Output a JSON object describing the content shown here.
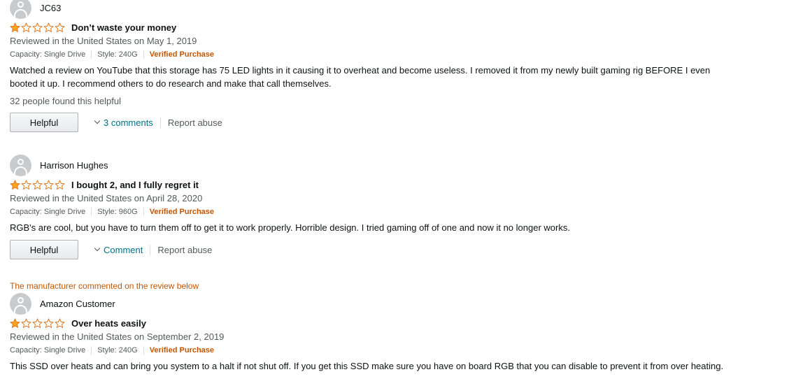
{
  "reviews": [
    {
      "name": "JC63",
      "rating": 1,
      "title": "Don’t waste your money",
      "date": "Reviewed in the United States on May 1, 2019",
      "capacity": "Capacity: Single Drive",
      "style": "Style: 240G",
      "verified": "Verified Purchase",
      "body_line1": "Watched a review on YouTube that this storage has 75 LED lights in it causing it to overheat and become useless. I removed it from my newly built gaming rig BEFORE I even",
      "body_line2": "booted it up. I recommend others to do research and make that call themselves.",
      "helpful_count": "32 people found this helpful",
      "helpful_label": "Helpful",
      "comments_label": "3 comments",
      "report_label": "Report abuse"
    },
    {
      "name": "Harrison Hughes",
      "rating": 1,
      "title": "I bought 2, and I fully regret it",
      "date": "Reviewed in the United States on April 28, 2020",
      "capacity": "Capacity: Single Drive",
      "style": "Style: 960G",
      "verified": "Verified Purchase",
      "body_line1": "RGB's are cool, but you have to turn them off to get it to work properly. Horrible design. I tried gaming off of one and now it no longer works.",
      "helpful_label": "Helpful",
      "comments_label": "Comment",
      "report_label": "Report abuse"
    },
    {
      "name": "Amazon Customer",
      "rating": 1,
      "title": "Over heats easily",
      "date": "Reviewed in the United States on September 2, 2019",
      "capacity": "Capacity: Single Drive",
      "style": "Style: 240G",
      "verified": "Verified Purchase",
      "body_line1": "This SSD over heats and can bring you system to a halt if not shut off. If you get this SSD make sure you have on board RGB that you can disable to prevent it from over heating."
    }
  ],
  "manufacturer_note": "The manufacturer commented on the review below",
  "colors": {
    "star_fill": "#ffa41c",
    "star_outline": "#de7921",
    "verified": "#c45500",
    "link": "#007185"
  }
}
